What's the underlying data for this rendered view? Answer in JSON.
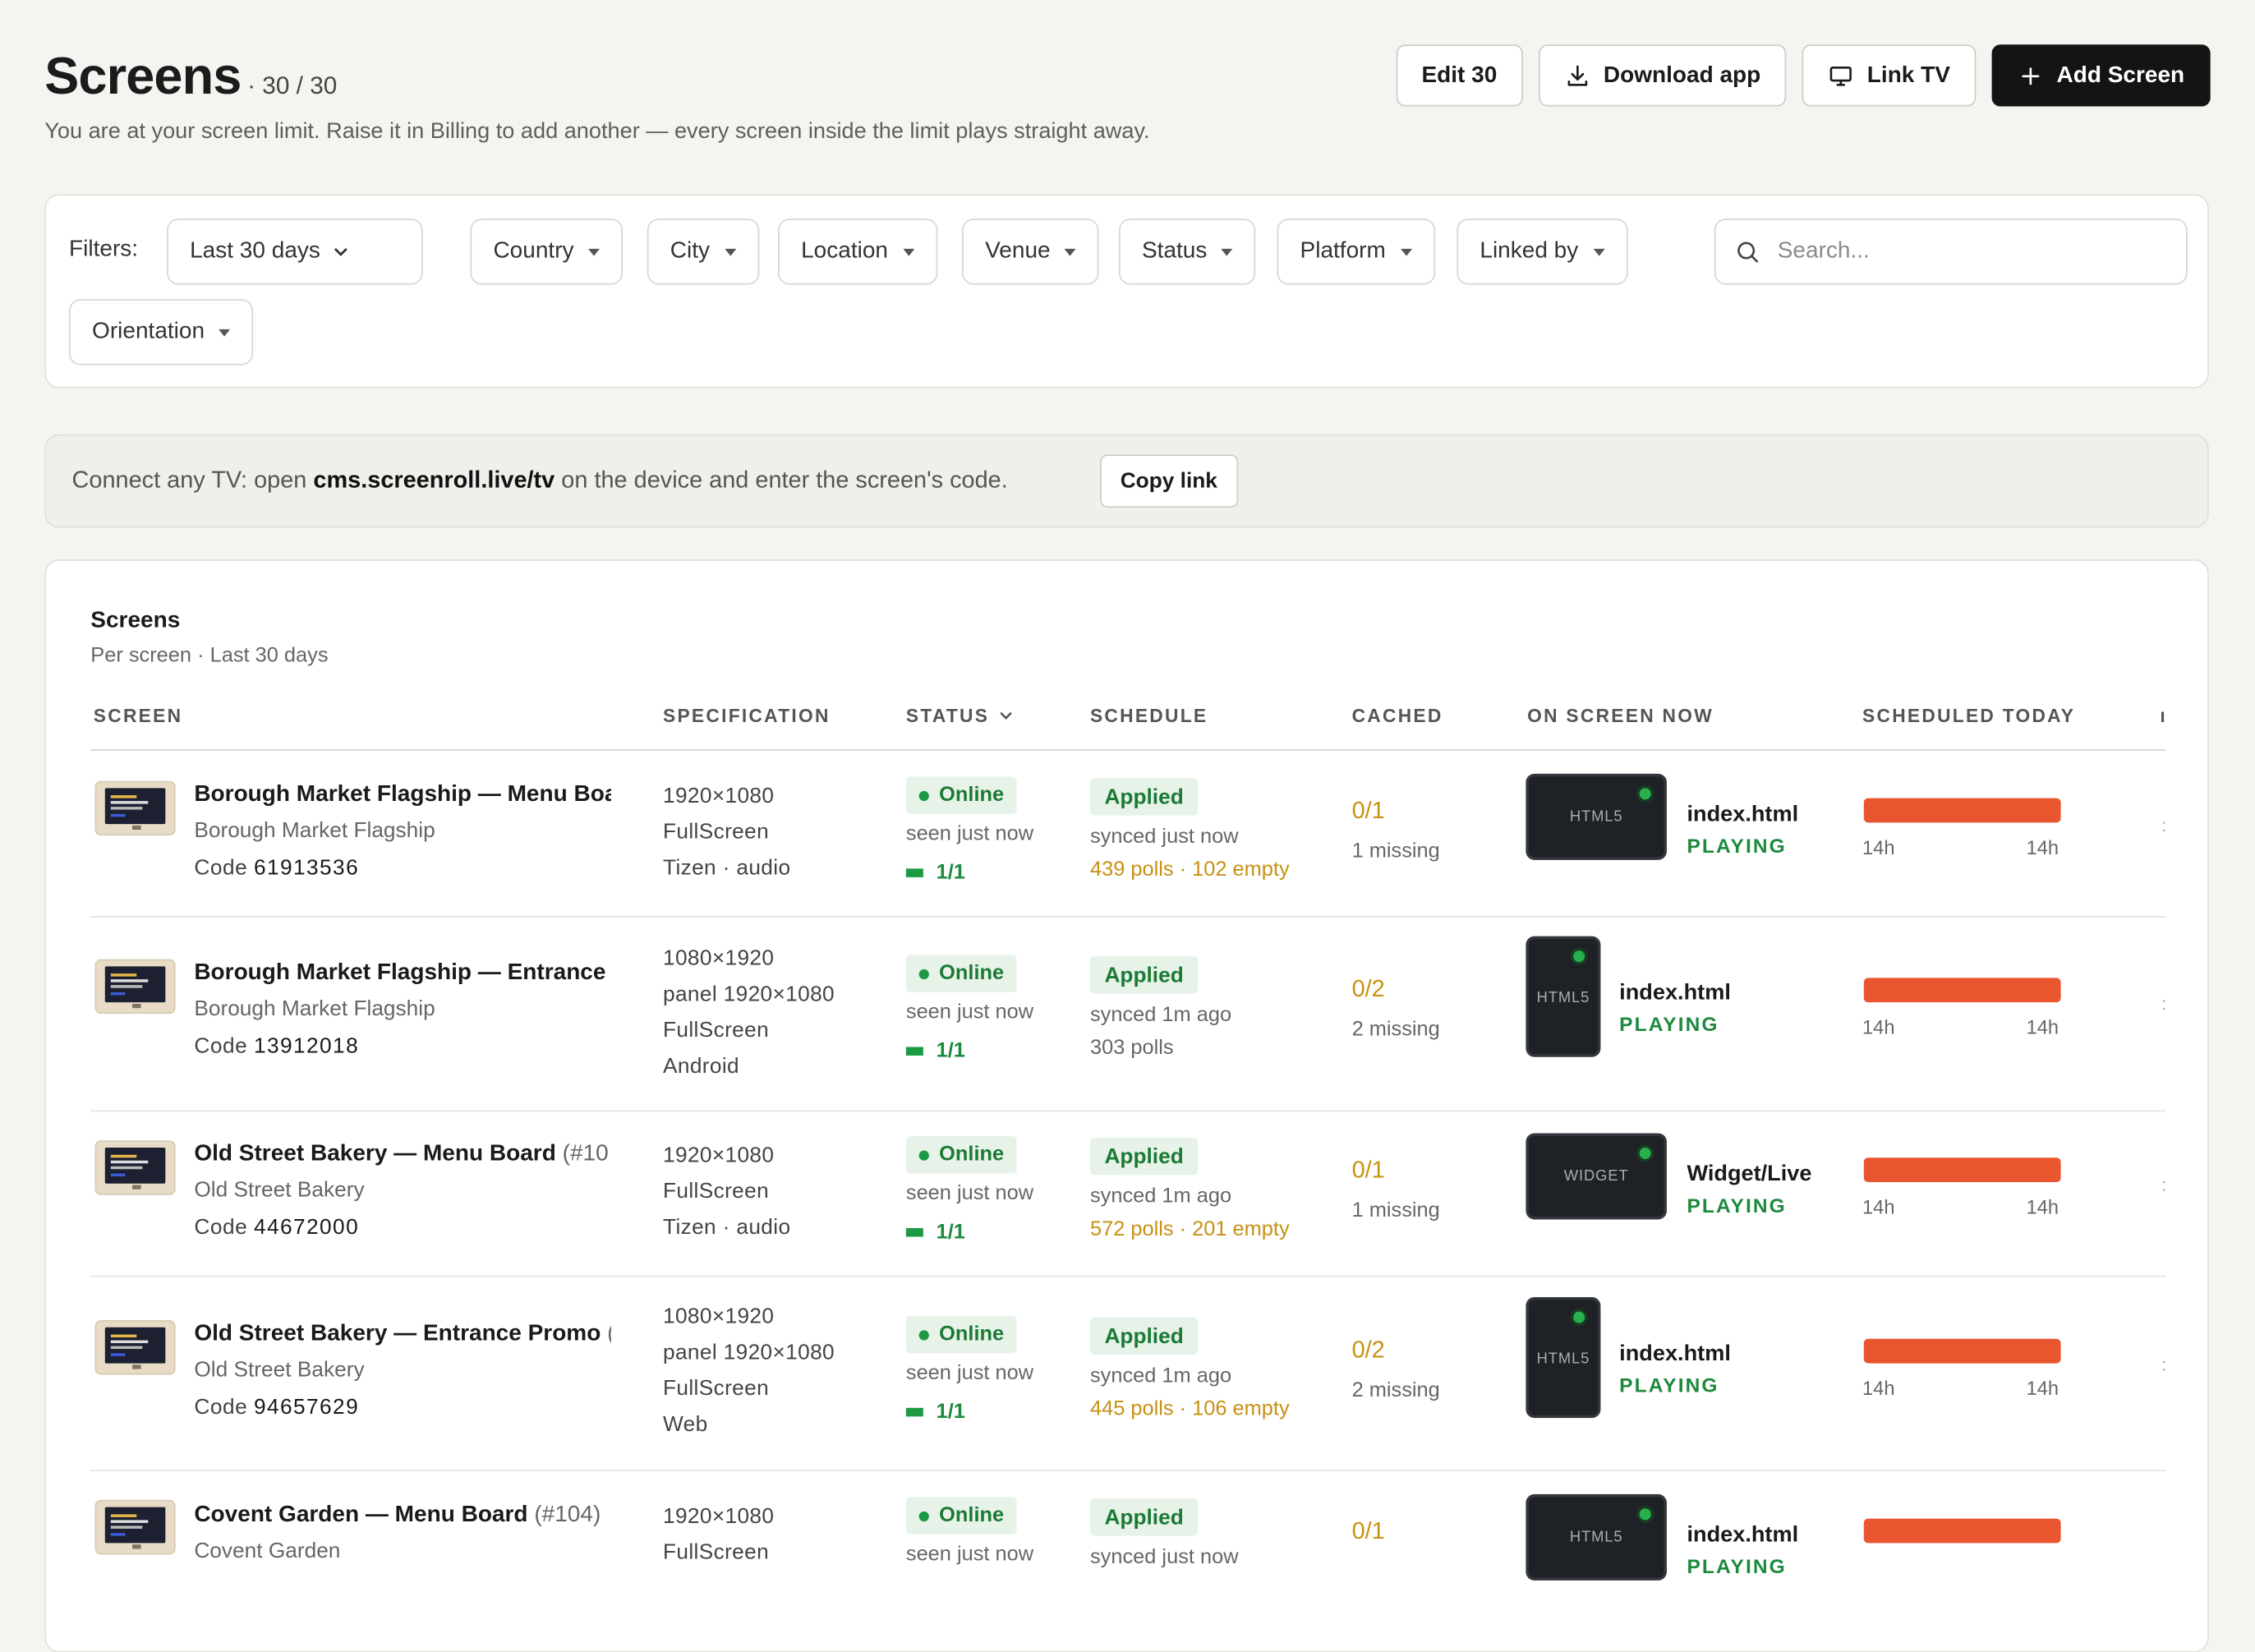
{
  "header": {
    "title": "Screens",
    "count": "· 30 / 30",
    "subtitle": "You are at your screen limit. Raise it in Billing to add another — every screen inside the limit plays straight away.",
    "buttons": {
      "edit": "Edit 30",
      "download": "Download app",
      "link_tv": "Link TV",
      "add": "Add Screen"
    }
  },
  "filters": {
    "label": "Filters:",
    "range": "Last 30 days",
    "country": "Country",
    "city": "City",
    "location": "Location",
    "venue": "Venue",
    "status": "Status",
    "platform": "Platform",
    "linked_by": "Linked by",
    "orientation": "Orientation",
    "search_placeholder": "Search..."
  },
  "connect": {
    "prefix": "Connect any TV: open",
    "url": "cms.screenroll.live/tv",
    "suffix": "on the device and enter the screen's code.",
    "copy_label": "Copy link"
  },
  "table": {
    "title": "Screens",
    "subtitle": "Per screen · Last 30 days",
    "columns": {
      "screen": "SCREEN",
      "specification": "SPECIFICATION",
      "status": "STATUS",
      "schedule": "SCHEDULE",
      "cached": "CACHED",
      "on_screen_now": "ON SCREEN NOW",
      "scheduled_today": "SCHEDULED TODAY"
    },
    "rows": [
      {
        "name": "Borough Market Flagship — Menu Boa",
        "suffix": "",
        "location": "Borough Market Flagship",
        "code_label": "Code",
        "code": "61913536",
        "spec": [
          "1920×1080",
          "FullScreen",
          "Tizen · audio"
        ],
        "status": "Online",
        "seen": "seen just now",
        "ratio": "1/1",
        "schedule": "Applied",
        "synced": "synced just now",
        "polls": "439 polls · 102 empty",
        "cached": "0/1",
        "missing": "1 missing",
        "device_label": "HTML5",
        "file": "index.html",
        "state": "PLAYING",
        "hours_start": "14h",
        "hours_end": "14h"
      },
      {
        "name": "Borough Market Flagship — Entrance",
        "suffix": "",
        "location": "Borough Market Flagship",
        "code_label": "Code",
        "code": "13912018",
        "spec": [
          "1080×1920",
          "panel 1920×1080",
          "FullScreen",
          "Android"
        ],
        "status": "Online",
        "seen": "seen just now",
        "ratio": "1/1",
        "schedule": "Applied",
        "synced": "synced 1m ago",
        "polls": "303 polls",
        "cached": "0/2",
        "missing": "2 missing",
        "device_label": "HTML5",
        "file": "index.html",
        "state": "PLAYING",
        "hours_start": "14h",
        "hours_end": "14h"
      },
      {
        "name": "Old Street Bakery — Menu Board",
        "suffix": "(#10",
        "location": "Old Street Bakery",
        "code_label": "Code",
        "code": "44672000",
        "spec": [
          "1920×1080",
          "FullScreen",
          "Tizen · audio"
        ],
        "status": "Online",
        "seen": "seen just now",
        "ratio": "1/1",
        "schedule": "Applied",
        "synced": "synced 1m ago",
        "polls": "572 polls · 201 empty",
        "cached": "0/1",
        "missing": "1 missing",
        "device_label": "WIDGET",
        "file": "Widget/Live",
        "state": "PLAYING",
        "hours_start": "14h",
        "hours_end": "14h"
      },
      {
        "name": "Old Street Bakery — Entrance Promo",
        "suffix": "(",
        "location": "Old Street Bakery",
        "code_label": "Code",
        "code": "94657629",
        "spec": [
          "1080×1920",
          "panel 1920×1080",
          "FullScreen",
          "Web"
        ],
        "status": "Online",
        "seen": "seen just now",
        "ratio": "1/1",
        "schedule": "Applied",
        "synced": "synced 1m ago",
        "polls": "445 polls · 106 empty",
        "cached": "0/2",
        "missing": "2 missing",
        "device_label": "HTML5",
        "file": "index.html",
        "state": "PLAYING",
        "hours_start": "14h",
        "hours_end": "14h"
      },
      {
        "name": "Covent Garden — Menu Board",
        "suffix": "(#104)",
        "location": "Covent Garden",
        "spec": [
          "1920×1080",
          "FullScreen"
        ],
        "status": "Online",
        "seen": "seen just now",
        "schedule": "Applied",
        "synced": "synced just now",
        "cached": "0/1",
        "device_label": "HTML5",
        "file": "index.html",
        "state": "PLAYING"
      }
    ]
  },
  "colors": {
    "accent_dark": "#141414",
    "online_green": "#1c7a35",
    "warning_amber": "#c79112",
    "schedule_bar": "#e9552f"
  }
}
